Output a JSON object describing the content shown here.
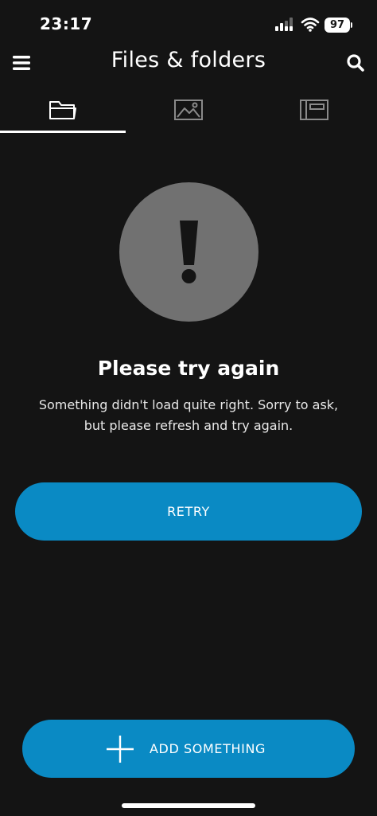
{
  "status_bar": {
    "time": "23:17",
    "battery": "97"
  },
  "header": {
    "title": "Files & folders"
  },
  "tabs": [
    {
      "icon": "folder-icon",
      "active": true
    },
    {
      "icon": "image-icon",
      "active": false
    },
    {
      "icon": "album-icon",
      "active": false
    }
  ],
  "error": {
    "icon": "exclamation-icon",
    "title": "Please try again",
    "message": "Something didn't load quite right. Sorry to ask, but please refresh and try again."
  },
  "buttons": {
    "retry": "RETRY",
    "add": "ADD SOMETHING"
  },
  "colors": {
    "background": "#141414",
    "accent": "#0a8ac4",
    "error_circle": "#717171"
  }
}
